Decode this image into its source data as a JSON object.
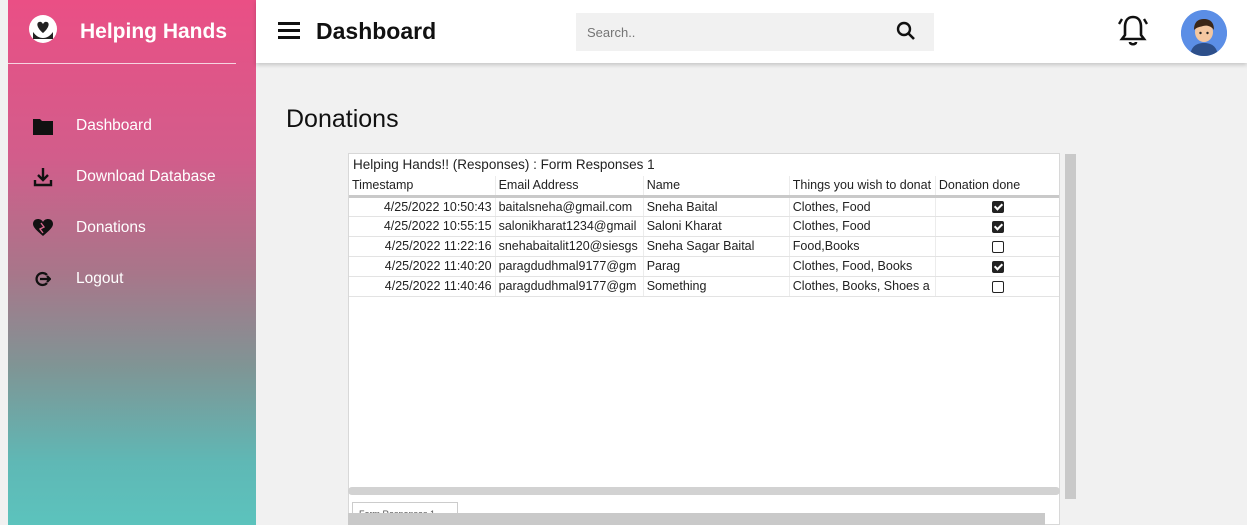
{
  "sidebar": {
    "brand": "Helping Hands",
    "items": [
      {
        "label": "Dashboard",
        "icon": "folder-icon"
      },
      {
        "label": "Download Database",
        "icon": "download-icon"
      },
      {
        "label": "Donations",
        "icon": "heart-icon"
      },
      {
        "label": "Logout",
        "icon": "logout-icon"
      }
    ]
  },
  "header": {
    "title": "Dashboard",
    "search_placeholder": "Search.."
  },
  "main": {
    "page_title": "Donations",
    "sheet": {
      "title": "Helping Hands!! (Responses) : Form Responses 1",
      "columns": [
        "Timestamp",
        "Email Address",
        "Name",
        "Things you wish to donat",
        "Donation done"
      ],
      "rows": [
        {
          "timestamp": "4/25/2022 10:50:43",
          "email": "baitalsneha@gmail.com",
          "name": "Sneha Baital",
          "things": "Clothes, Food",
          "done": true
        },
        {
          "timestamp": "4/25/2022 10:55:15",
          "email": "salonikharat1234@gmail",
          "name": "Saloni Kharat",
          "things": "Clothes, Food",
          "done": true
        },
        {
          "timestamp": "4/25/2022 11:22:16",
          "email": "snehabaitalit120@siesgs",
          "name": "Sneha Sagar Baital",
          "things": "Food,Books",
          "done": false
        },
        {
          "timestamp": "4/25/2022 11:40:20",
          "email": "paragdudhmal9177@gm",
          "name": "Parag",
          "things": "Clothes, Food, Books",
          "done": true
        },
        {
          "timestamp": "4/25/2022 11:40:46",
          "email": "paragdudhmal9177@gm",
          "name": "Something",
          "things": "Clothes, Books, Shoes a",
          "done": false
        }
      ],
      "tab_label": "Form Responses 1"
    }
  },
  "colors": {
    "sidebar_top": "#ea4f85",
    "sidebar_bottom": "#5cc3bd",
    "avatar": "#5b8ee6"
  }
}
